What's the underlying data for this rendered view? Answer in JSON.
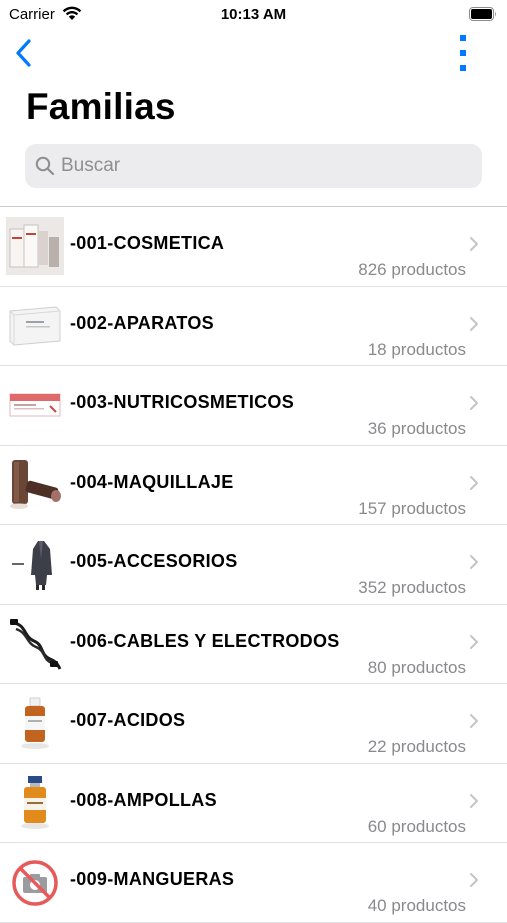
{
  "status_bar": {
    "carrier": "Carrier",
    "time": "10:13 AM"
  },
  "nav": {
    "back_icon": "chevron-left-icon",
    "more_icon": "vertical-dots-icon",
    "accent_color": "#007aff"
  },
  "page": {
    "title": "Familias"
  },
  "search": {
    "placeholder": "Buscar",
    "value": ""
  },
  "families": [
    {
      "name": "-001-COSMETICA",
      "count": "826 productos",
      "thumb": "cosmetic-products-image"
    },
    {
      "name": "-002-APARATOS",
      "count": "18 productos",
      "thumb": "device-box-image"
    },
    {
      "name": "-003-NUTRICOSMETICOS",
      "count": "36 productos",
      "thumb": "supplement-box-image"
    },
    {
      "name": "-004-MAQUILLAJE",
      "count": "157 productos",
      "thumb": "makeup-tubes-image"
    },
    {
      "name": "-005-ACCESORIOS",
      "count": "352 productos",
      "thumb": "robe-image"
    },
    {
      "name": "-006-CABLES Y ELECTRODOS",
      "count": "80 productos",
      "thumb": "cable-image"
    },
    {
      "name": "-007-ACIDOS",
      "count": "22 productos",
      "thumb": "acid-bottle-image"
    },
    {
      "name": "-008-AMPOLLAS",
      "count": "60 productos",
      "thumb": "ampoule-vial-image"
    },
    {
      "name": "-009-MANGUERAS",
      "count": "40 productos",
      "thumb": "no-image-placeholder-icon"
    }
  ]
}
